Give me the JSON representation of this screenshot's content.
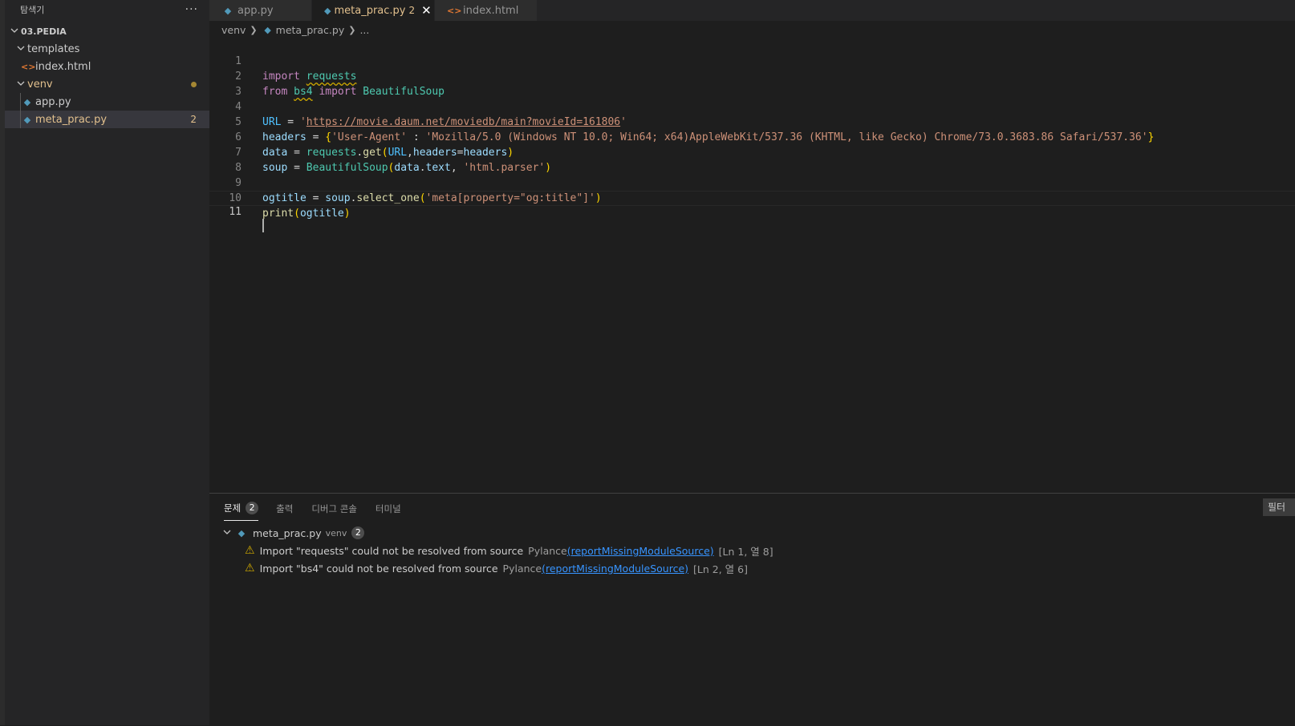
{
  "explorer": {
    "title": "탐색기",
    "more_icon": "ellipsis-icon",
    "root_folder": "03.PEDIA",
    "items": [
      {
        "label": "templates",
        "type": "folder"
      },
      {
        "label": "index.html",
        "type": "html-file"
      },
      {
        "label": "venv",
        "type": "folder"
      },
      {
        "label": "app.py",
        "type": "python-file"
      },
      {
        "label": "meta_prac.py",
        "type": "python-file",
        "badge": "2"
      }
    ]
  },
  "tabs": [
    {
      "label": "app.py",
      "icon": "python-file-icon"
    },
    {
      "label": "meta_prac.py",
      "icon": "python-file-icon",
      "count": "2",
      "close": "✕"
    },
    {
      "label": "index.html",
      "icon": "html-file-icon"
    }
  ],
  "breadcrumb": {
    "folder": "venv",
    "file": "meta_prac.py",
    "more": "..."
  },
  "editor": {
    "line_numbers": [
      "1",
      "2",
      "3",
      "4",
      "5",
      "6",
      "7",
      "8",
      "9",
      "10",
      "11"
    ],
    "current_line": "11",
    "code": {
      "l1_import": "import",
      "l1_module": "requests",
      "l2_from": "from",
      "l2_module": "bs4",
      "l2_import": "import",
      "l2_class": "BeautifulSoup",
      "l4_var": "URL",
      "l4_eq": " = ",
      "l4_q1": "'",
      "l4_url": "https://movie.daum.net/moviedb/main?movieId=161806",
      "l4_q2": "'",
      "l5_var": "headers",
      "l5_eq": " = ",
      "l5_brace_open": "{",
      "l5_key": "'User-Agent'",
      "l5_colon": " : ",
      "l5_value": "'Mozilla/5.0 (Windows NT 10.0; Win64; x64)AppleWebKit/537.36 (KHTML, like Gecko) Chrome/73.0.3683.86 Safari/537.36'",
      "l5_brace_close": "}",
      "l6_var": "data",
      "l6_eq": " = ",
      "l6_obj": "requests",
      "l6_dot": ".",
      "l6_fn": "get",
      "l6_popen": "(",
      "l6_arg1": "URL",
      "l6_comma": ",",
      "l6_kw": "headers",
      "l6_assign": "=",
      "l6_arg2": "headers",
      "l6_pclose": ")",
      "l7_var": "soup",
      "l7_eq": " = ",
      "l7_class": "BeautifulSoup",
      "l7_popen": "(",
      "l7_arg1": "data",
      "l7_dot": ".",
      "l7_attr": "text",
      "l7_comma": ", ",
      "l7_str": "'html.parser'",
      "l7_pclose": ")",
      "l9_var": "ogtitle",
      "l9_eq": " = ",
      "l9_obj": "soup",
      "l9_dot": ".",
      "l9_fn": "select_one",
      "l9_popen": "(",
      "l9_str": "'meta[property=\"og:title\"]'",
      "l9_pclose": ")",
      "l10_fn": "print",
      "l10_popen": "(",
      "l10_arg": "ogtitle",
      "l10_pclose": ")"
    }
  },
  "panel": {
    "tabs": [
      {
        "label": "문제",
        "count": "2"
      },
      {
        "label": "출력"
      },
      {
        "label": "디버그 콘솔"
      },
      {
        "label": "터미널"
      }
    ],
    "filter_label": "필터",
    "group": {
      "file": "meta_prac.py",
      "folder": "venv",
      "count": "2"
    },
    "problems": [
      {
        "message": "Import \"requests\" could not be resolved from source",
        "source": "Pylance",
        "code": "(reportMissingModuleSource)",
        "location": "[Ln 1, 열 8]"
      },
      {
        "message": "Import \"bs4\" could not be resolved from source",
        "source": "Pylance",
        "code": "(reportMissingModuleSource)",
        "location": "[Ln 2, 열 6]"
      }
    ]
  },
  "colors": {
    "background": "#1e1e1e",
    "sidebar": "#252526",
    "modified": "#e2c08d",
    "warning": "#cca700",
    "link": "#3794ff"
  }
}
